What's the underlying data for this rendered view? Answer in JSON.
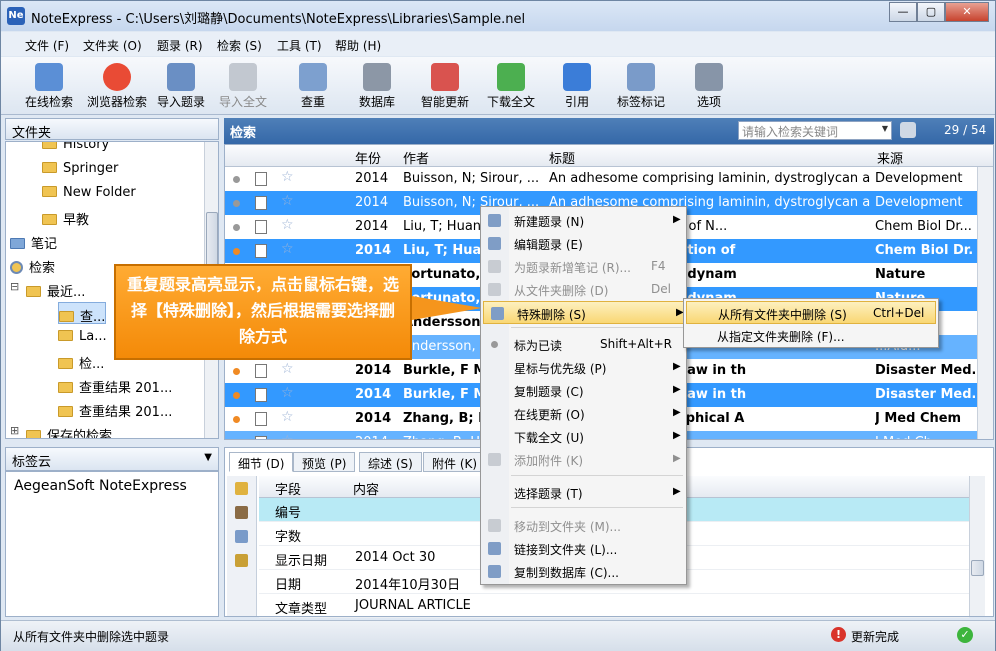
{
  "window": {
    "title": "NoteExpress - C:\\Users\\刘璐静\\Documents\\NoteExpress\\Libraries\\Sample.nel",
    "icon_text": "Ne"
  },
  "window_buttons": [
    "—",
    "▢",
    "✕"
  ],
  "menu": [
    "文件 (F)",
    "文件夹 (O)",
    "题录 (R)",
    "检索 (S)",
    "工具 (T)",
    "帮助 (H)"
  ],
  "toolbar": [
    {
      "label": "在线检索",
      "icon": "online-search-icon",
      "color": "#5b8fd6"
    },
    {
      "label": "浏览器检索",
      "icon": "browser-icon",
      "color": "#e94b35"
    },
    {
      "label": "导入题录",
      "icon": "import-icon",
      "color": "#6a8fc4"
    },
    {
      "label": "导入全文",
      "icon": "import-fulltext-icon",
      "color": "#c2c8d0",
      "disabled": true
    },
    {
      "label": "查重",
      "icon": "dedupe-icon",
      "color": "#7da0cf"
    },
    {
      "label": "数据库",
      "icon": "database-icon",
      "color": "#8c97a6"
    },
    {
      "label": "智能更新",
      "icon": "smart-update-icon",
      "color": "#d9534f"
    },
    {
      "label": "下载全文",
      "icon": "download-icon",
      "color": "#4caf50"
    },
    {
      "label": "引用",
      "icon": "cite-icon",
      "color": "#3b7dd8"
    },
    {
      "label": "标签标记",
      "icon": "tag-icon",
      "color": "#7a9bc9"
    },
    {
      "label": "选项",
      "icon": "options-icon",
      "color": "#8795a8"
    }
  ],
  "left": {
    "header": "文件夹",
    "tree": [
      {
        "label": "History",
        "indent": 64,
        "type": "folder"
      },
      {
        "label": "Springer",
        "indent": 64,
        "type": "folder"
      },
      {
        "label": "New Folder",
        "indent": 64,
        "type": "folder"
      },
      {
        "label": "早教",
        "indent": 64,
        "type": "folder"
      },
      {
        "label": "笔记",
        "indent": 32,
        "type": "note",
        "toggle": "⊞"
      },
      {
        "label": "检索",
        "indent": 32,
        "type": "search",
        "toggle": "⊟"
      },
      {
        "label": "最近...",
        "indent": 48,
        "type": "folder",
        "toggle": "⊟"
      },
      {
        "label": "查...",
        "indent": 80,
        "type": "folder",
        "selected": true
      },
      {
        "label": "La...",
        "indent": 80,
        "type": "folder"
      },
      {
        "label": "检...",
        "indent": 80,
        "type": "folder"
      },
      {
        "label": "查重结果 201...",
        "indent": 80,
        "type": "folder"
      },
      {
        "label": "查重结果 201...",
        "indent": 80,
        "type": "folder"
      },
      {
        "label": "保存的检索",
        "indent": 48,
        "type": "folder",
        "toggle": "⊞"
      }
    ]
  },
  "tagcloud": {
    "header": "标签云",
    "content": "AegeanSoft  NoteExpress",
    "arrow": "▼"
  },
  "search": {
    "header": "检索",
    "placeholder": "请输入检索关键词",
    "count": "29 / 54",
    "arrow": "▼"
  },
  "grid": {
    "columns": [
      "年份",
      "作者",
      "标题",
      "来源"
    ],
    "rows": [
      {
        "year": "2014",
        "author": "Buisson, N; Sirour, ...",
        "title": "An adhesome comprising laminin, dystroglycan a...",
        "source": "Development",
        "state": "normal"
      },
      {
        "year": "2014",
        "author": "Buisson, N; Sirour, ...",
        "title": "An adhesome comprising laminin, dystroglycan a...",
        "source": "Development",
        "state": "sel"
      },
      {
        "year": "2014",
        "author": "Liu, T; Huang",
        "title": "Biological Evaluation of N...",
        "source": "Chem Biol Dr...",
        "state": "normal"
      },
      {
        "year": "2014",
        "author": "Liu, T; Huang",
        "title": "d Biological Evaluation of",
        "source": "Chem Biol Dr.",
        "state": "selbold",
        "dot": "#f08a24"
      },
      {
        "year": "2014",
        "author": "Fortunato, S",
        "title": "ParaHox gene and dynam",
        "source": "Nature",
        "state": "bold",
        "dot": "#f08a24"
      },
      {
        "year": "2014",
        "author": "Fortunato, S",
        "title": "ParaHox gene and dynam",
        "source": "Nature",
        "state": "selbold"
      },
      {
        "year": "2014",
        "author": "Andersson, C",
        "title": "...",
        "source": "...Aid.",
        "state": "bold",
        "dot": "#f08a24"
      },
      {
        "year": "2014",
        "author": "Andersson, C",
        "title": "...",
        "source": "...Aid...",
        "state": "selhalf"
      },
      {
        "year": "2014",
        "author": "Burkle, F M",
        "title": "Survival, and the Law in th",
        "source": "Disaster Med.",
        "state": "bold",
        "dot": "#f08a24"
      },
      {
        "year": "2014",
        "author": "Burkle, F M",
        "title": "Survival, and the Law in th",
        "source": "Disaster Med.",
        "state": "selbold",
        "dot": "#f08a24"
      },
      {
        "year": "2014",
        "author": "Zhang, B; H",
        "title": "ew Method for Graphical A",
        "source": "J Med Chem",
        "state": "bold",
        "dot": "#f08a24"
      },
      {
        "year": "2014",
        "author": "Zhang, B; H",
        "title": "...",
        "source": "J Med Ch...",
        "state": "selhalf"
      }
    ]
  },
  "detail": {
    "tabs": [
      "细节 (D)",
      "预览 (P)",
      "综述 (S)",
      "附件 (K)"
    ],
    "columns": [
      "字段",
      "内容"
    ],
    "rows": [
      {
        "field": "编号",
        "value": ""
      },
      {
        "field": "字数",
        "value": ""
      },
      {
        "field": "显示日期",
        "value": "2014 Oct 30"
      },
      {
        "field": "日期",
        "value": "2014年10月30日"
      },
      {
        "field": "文章类型",
        "value": "JOURNAL ARTICLE"
      }
    ]
  },
  "context_menu": [
    {
      "label": "新建题录 (N)",
      "arrow": "▶"
    },
    {
      "label": "编辑题录 (E)"
    },
    {
      "label": "为题录新增笔记 (R)...",
      "key": "F4",
      "disabled": true
    },
    {
      "label": "从文件夹删除 (D)",
      "key": "Del",
      "disabled": true
    },
    {
      "label": "特殊删除 (S)",
      "arrow": "▶",
      "highlight": true
    },
    {
      "label": "标为已读",
      "key": "Shift+Alt+R"
    },
    {
      "label": "星标与优先级 (P)",
      "arrow": "▶"
    },
    {
      "label": "复制题录 (C)",
      "arrow": "▶"
    },
    {
      "label": "在线更新 (O)",
      "arrow": "▶"
    },
    {
      "label": "下载全文 (U)",
      "arrow": "▶"
    },
    {
      "label": "添加附件 (K)",
      "arrow": "▶",
      "disabled": true
    },
    {
      "label": "选择题录 (T)",
      "arrow": "▶"
    },
    {
      "label": "移动到文件夹 (M)...",
      "disabled": true
    },
    {
      "label": "链接到文件夹 (L)..."
    },
    {
      "label": "复制到数据库 (C)..."
    }
  ],
  "submenu": [
    {
      "label": "从所有文件夹中删除 (S)",
      "key": "Ctrl+Del",
      "highlight": true
    },
    {
      "label": "从指定文件夹删除 (F)..."
    }
  ],
  "callout": {
    "text": "重复题录高亮显示，点击鼠标右键，选择【特殊删除】，然后根据需要选择删除方式"
  },
  "status": {
    "left": "从所有文件夹中删除选中题录",
    "right": "更新完成"
  }
}
